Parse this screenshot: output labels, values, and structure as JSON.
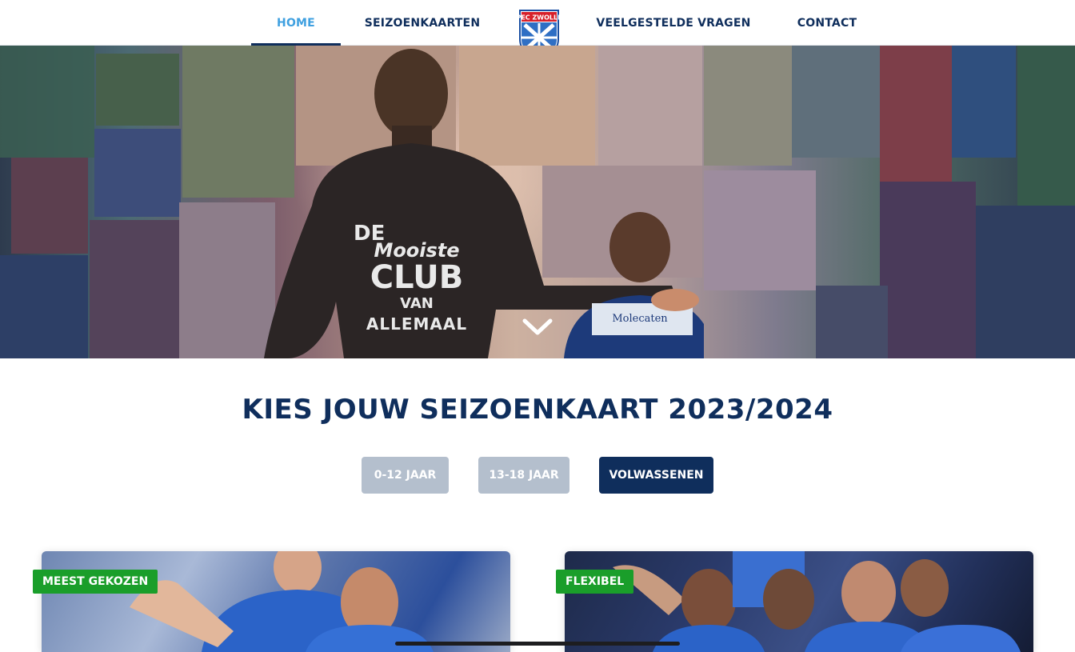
{
  "nav": {
    "items": [
      {
        "label": "HOME",
        "active": true
      },
      {
        "label": "SEIZOENKAARTEN",
        "active": false
      },
      {
        "label": "VEELGESTELDE VRAGEN",
        "active": false
      },
      {
        "label": "CONTACT",
        "active": false
      }
    ],
    "logo_text": "PEC ZWOLLE"
  },
  "hero": {
    "hoodie_text": [
      "DE",
      "Mooiste",
      "CLUB",
      "VAN",
      "ALLEMAAL"
    ],
    "shirt_sponsor": "Molecaten"
  },
  "section": {
    "title": "KIES JOUW SEIZOENKAART 2023/2024",
    "age_buttons": [
      {
        "label": "0-12 JAAR",
        "active": false
      },
      {
        "label": "13-18 JAAR",
        "active": false
      },
      {
        "label": "VOLWASSENEN",
        "active": true
      }
    ]
  },
  "cards": [
    {
      "badge": "MEEST GEKOZEN"
    },
    {
      "badge": "FLEXIBEL"
    }
  ],
  "colors": {
    "navy": "#0f2e5c",
    "active_link": "#3fa0e0",
    "badge_green": "#1a9e2a",
    "inactive_button": "#b4bfcd"
  }
}
